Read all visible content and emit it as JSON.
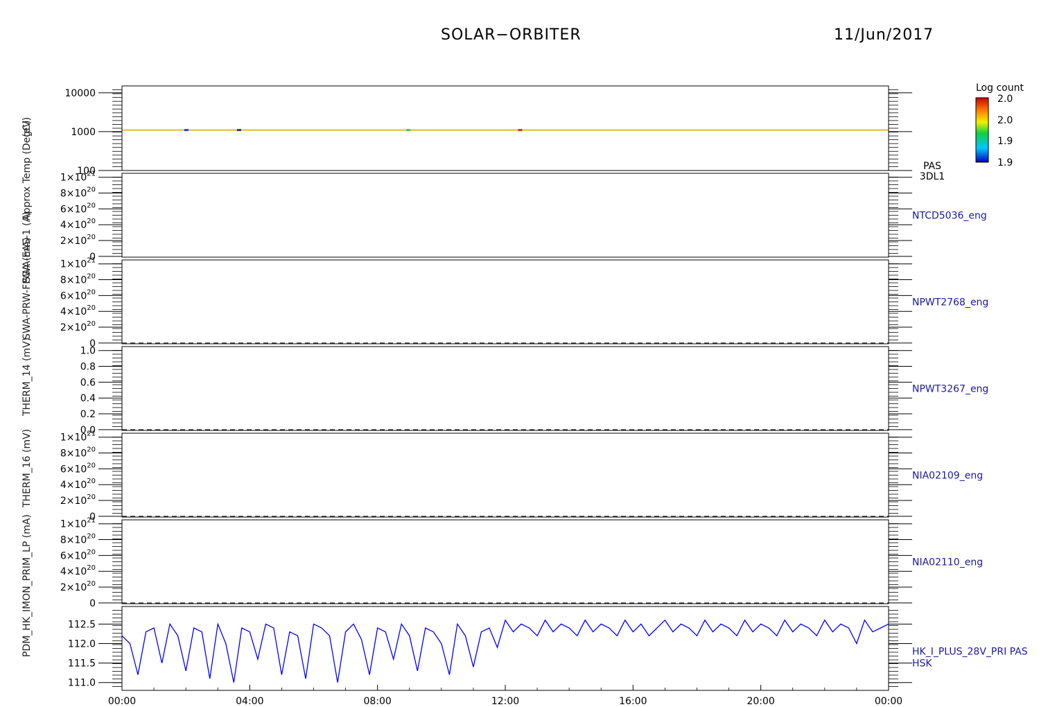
{
  "title": "SOLAR−ORBITER",
  "date": "11/Jun/2017",
  "y_axis_labels": [
    "(eV)",
    "Approx Temp (DegC)",
    "SWA-EAS-1 (A)",
    "SWA-PRW-FPGA (mA)",
    "THERM_14 (mV)",
    "THERM_16 (mV)",
    "PDM_HK_IMON_PRIM_LP (mA)"
  ],
  "colors": {
    "axis": "#000000",
    "panel_label": "#1a1aa0",
    "trace": "#0000ff",
    "spectrum_line": "#e8b820"
  },
  "colorbar": {
    "title": "Log count",
    "ticks": [
      "2.0",
      "2.0",
      "1.9",
      "1.9"
    ]
  },
  "chart_data": [
    {
      "type": "heatmap",
      "panel": "PAS 3DL1",
      "label_lines": [
        "PAS",
        "3DL1"
      ],
      "ylabel": "(eV)",
      "yscale": "log",
      "ylim": [
        100,
        15000
      ],
      "yticks": [
        {
          "v": 100,
          "label": "100"
        },
        {
          "v": 1000,
          "label": "1000"
        },
        {
          "v": 10000,
          "label": "10000"
        }
      ],
      "band_energy": 1100,
      "value_range": [
        1.9,
        2.0
      ]
    },
    {
      "type": "line",
      "panel": "NTCD5036_eng",
      "label_lines": [
        "NTCD5036_eng"
      ],
      "ylabel": "Approx Temp (DegC)",
      "ylim": [
        -1e+19,
        1.05e+21
      ],
      "dashed_zero": false,
      "yticks": [
        {
          "v": 0,
          "mant": "0"
        },
        {
          "v": 2e+20,
          "mant": "2",
          "exp": "20"
        },
        {
          "v": 4e+20,
          "mant": "4",
          "exp": "20"
        },
        {
          "v": 6e+20,
          "mant": "6",
          "exp": "20"
        },
        {
          "v": 8e+20,
          "mant": "8",
          "exp": "20"
        },
        {
          "v": 1e+21,
          "mant": "1",
          "exp": "21"
        }
      ]
    },
    {
      "type": "line",
      "panel": "NPWT2768_eng",
      "label_lines": [
        "NPWT2768_eng"
      ],
      "ylabel": "SWA-EAS-1 (A)",
      "ylim": [
        -1e+19,
        1.05e+21
      ],
      "dashed_zero": true,
      "yticks": [
        {
          "v": 0,
          "mant": "0"
        },
        {
          "v": 2e+20,
          "mant": "2",
          "exp": "20"
        },
        {
          "v": 4e+20,
          "mant": "4",
          "exp": "20"
        },
        {
          "v": 6e+20,
          "mant": "6",
          "exp": "20"
        },
        {
          "v": 8e+20,
          "mant": "8",
          "exp": "20"
        },
        {
          "v": 1e+21,
          "mant": "1",
          "exp": "21"
        }
      ]
    },
    {
      "type": "line",
      "panel": "NPWT3267_eng",
      "label_lines": [
        "NPWT3267_eng"
      ],
      "ylabel": "SWA-PRW-FPGA (mA)",
      "ylim": [
        -0.01,
        1.05
      ],
      "dashed_zero": true,
      "yticks": [
        {
          "v": 0,
          "label": "0.0"
        },
        {
          "v": 0.2,
          "label": "0.2"
        },
        {
          "v": 0.4,
          "label": "0.4"
        },
        {
          "v": 0.6,
          "label": "0.6"
        },
        {
          "v": 0.8,
          "label": "0.8"
        },
        {
          "v": 1.0,
          "label": "1.0"
        }
      ]
    },
    {
      "type": "line",
      "panel": "NIA02109_eng",
      "label_lines": [
        "NIA02109_eng"
      ],
      "ylabel": "THERM_14 (mV)",
      "ylim": [
        -1e+19,
        1.05e+21
      ],
      "dashed_zero": true,
      "yticks": [
        {
          "v": 0,
          "mant": "0"
        },
        {
          "v": 2e+20,
          "mant": "2",
          "exp": "20"
        },
        {
          "v": 4e+20,
          "mant": "4",
          "exp": "20"
        },
        {
          "v": 6e+20,
          "mant": "6",
          "exp": "20"
        },
        {
          "v": 8e+20,
          "mant": "8",
          "exp": "20"
        },
        {
          "v": 1e+21,
          "mant": "1",
          "exp": "21"
        }
      ]
    },
    {
      "type": "line",
      "panel": "NIA02110_eng",
      "label_lines": [
        "NIA02110_eng"
      ],
      "ylabel": "THERM_16 (mV)",
      "ylim": [
        -1e+19,
        1.05e+21
      ],
      "dashed_zero": true,
      "yticks": [
        {
          "v": 0,
          "mant": "0"
        },
        {
          "v": 2e+20,
          "mant": "2",
          "exp": "20"
        },
        {
          "v": 4e+20,
          "mant": "4",
          "exp": "20"
        },
        {
          "v": 6e+20,
          "mant": "6",
          "exp": "20"
        },
        {
          "v": 8e+20,
          "mant": "8",
          "exp": "20"
        },
        {
          "v": 1e+21,
          "mant": "1",
          "exp": "21"
        }
      ]
    },
    {
      "type": "line",
      "panel": "HK_I_PLUS_28V_PRI PAS HSK",
      "label_lines": [
        "HK_I_PLUS_28V_PRI PAS",
        "HSK"
      ],
      "ylabel": "PDM_HK_IMON_PRIM_LP (mA)",
      "ylim": [
        110.8,
        112.95
      ],
      "yticks": [
        {
          "v": 111.0,
          "label": "111.0"
        },
        {
          "v": 111.5,
          "label": "111.5"
        },
        {
          "v": 112.0,
          "label": "112.0"
        },
        {
          "v": 112.5,
          "label": "112.5"
        }
      ],
      "series": [
        {
          "x_hours": [
            0,
            0.25,
            0.5,
            0.75,
            1,
            1.25,
            1.5,
            1.75,
            2,
            2.25,
            2.5,
            2.75,
            3,
            3.25,
            3.5,
            3.75,
            4,
            4.25,
            4.5,
            4.75,
            5,
            5.25,
            5.5,
            5.75,
            6,
            6.25,
            6.5,
            6.75,
            7,
            7.25,
            7.5,
            7.75,
            8,
            8.25,
            8.5,
            8.75,
            9,
            9.25,
            9.5,
            9.75,
            10,
            10.25,
            10.5,
            10.75,
            11,
            11.25,
            11.5,
            11.75,
            12,
            12.25,
            12.5,
            12.75,
            13,
            13.25,
            13.5,
            13.75,
            14,
            14.25,
            14.5,
            14.75,
            15,
            15.25,
            15.5,
            15.75,
            16,
            16.25,
            16.5,
            16.75,
            17,
            17.25,
            17.5,
            17.75,
            18,
            18.25,
            18.5,
            18.75,
            19,
            19.25,
            19.5,
            19.75,
            20,
            20.25,
            20.5,
            20.75,
            21,
            21.25,
            21.5,
            21.75,
            22,
            22.25,
            22.5,
            22.75,
            23,
            23.25,
            23.5,
            23.75,
            24
          ],
          "values": [
            112.2,
            112.0,
            111.2,
            112.3,
            112.4,
            111.5,
            112.5,
            112.2,
            111.3,
            112.4,
            112.3,
            111.1,
            112.5,
            112.0,
            111.0,
            112.4,
            112.3,
            111.6,
            112.5,
            112.4,
            111.2,
            112.3,
            112.2,
            111.1,
            112.5,
            112.4,
            112.2,
            111.0,
            112.3,
            112.5,
            112.1,
            111.2,
            112.4,
            112.3,
            111.6,
            112.5,
            112.2,
            111.3,
            112.4,
            112.3,
            112.0,
            111.2,
            112.5,
            112.2,
            111.4,
            112.3,
            112.4,
            111.9,
            112.6,
            112.3,
            112.5,
            112.4,
            112.2,
            112.6,
            112.3,
            112.5,
            112.4,
            112.2,
            112.6,
            112.3,
            112.5,
            112.4,
            112.2,
            112.6,
            112.3,
            112.5,
            112.2,
            112.4,
            112.6,
            112.3,
            112.5,
            112.4,
            112.2,
            112.6,
            112.3,
            112.5,
            112.4,
            112.2,
            112.6,
            112.3,
            112.5,
            112.4,
            112.2,
            112.6,
            112.3,
            112.5,
            112.4,
            112.2,
            112.6,
            112.3,
            112.5,
            112.4,
            112.0,
            112.6,
            112.3,
            112.4,
            112.5
          ]
        }
      ]
    }
  ],
  "x_axis": {
    "range_hours": [
      0,
      24
    ],
    "ticks": [
      "00:00",
      "04:00",
      "08:00",
      "12:00",
      "16:00",
      "20:00",
      "00:00"
    ]
  }
}
